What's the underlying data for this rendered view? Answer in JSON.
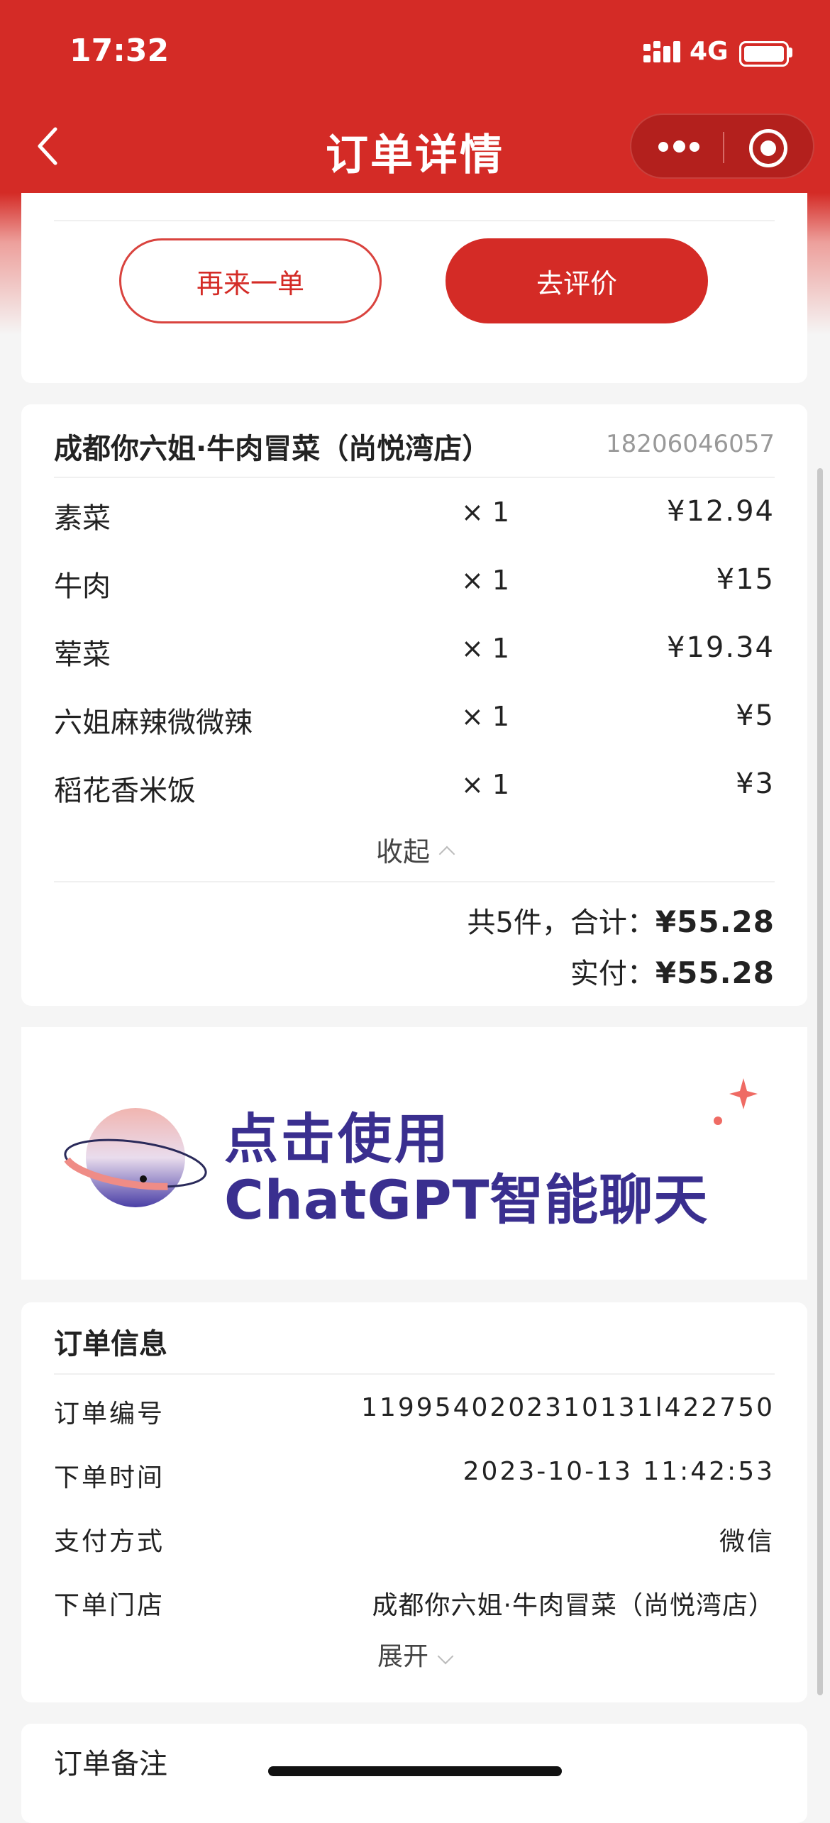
{
  "status_bar": {
    "time": "17:32",
    "network": "4G"
  },
  "nav": {
    "title": "订单详情"
  },
  "actions": {
    "reorder_label": "再来一单",
    "review_label": "去评价"
  },
  "store": {
    "name": "成都你六姐·牛肉冒菜（尚悦湾店）",
    "phone": "18206046057",
    "items": [
      {
        "name": "素菜",
        "qty": "× 1",
        "price": "¥12.94"
      },
      {
        "name": "牛肉",
        "qty": "× 1",
        "price": "¥15"
      },
      {
        "name": "荤菜",
        "qty": "× 1",
        "price": "¥19.34"
      },
      {
        "name": "六姐麻辣微微辣",
        "qty": "× 1",
        "price": "¥5"
      },
      {
        "name": "稻花香米饭",
        "qty": "× 1",
        "price": "¥3"
      }
    ],
    "collapse_label": "收起",
    "total_prefix": "共5件，合计：",
    "total_value": "¥55.28",
    "paid_prefix": "实付：",
    "paid_value": "¥55.28"
  },
  "banner": {
    "line1": "点击使用",
    "line2": "ChatGPT智能聊天"
  },
  "order_info": {
    "title": "订单信息",
    "rows": [
      {
        "label": "订单编号",
        "value": "1199540202310131l422750"
      },
      {
        "label": "下单时间",
        "value": "2023-10-13 11:42:53"
      },
      {
        "label": "支付方式",
        "value": "微信"
      },
      {
        "label": "下单门店",
        "value": "成都你六姐·牛肉冒菜（尚悦湾店）"
      }
    ],
    "expand_label": "展开"
  },
  "remark": {
    "title": "订单备注"
  },
  "colors": {
    "brand_red": "#d42b26",
    "banner_text": "#3a2f8f"
  }
}
